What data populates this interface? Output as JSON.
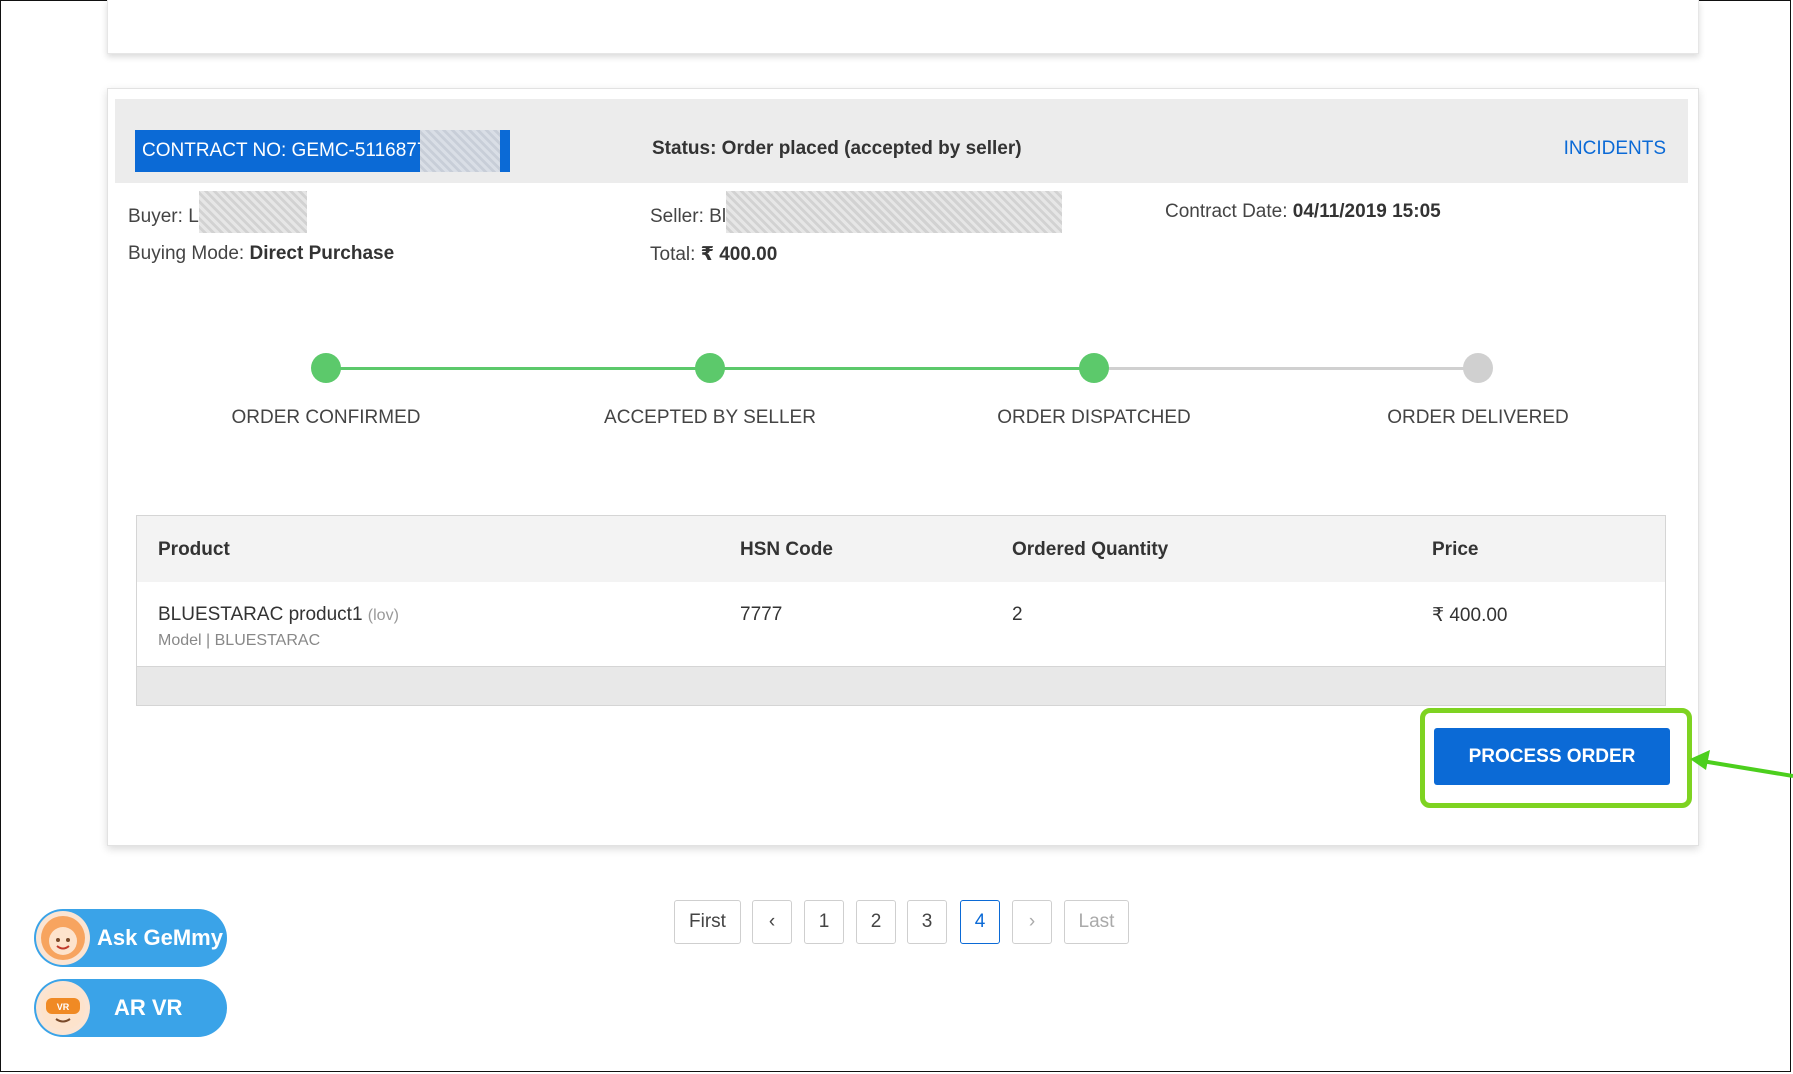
{
  "contract": {
    "number_label": "CONTRACT NO:  GEMC-5116877",
    "status": "Status: Order placed (accepted by seller)",
    "incidents": "INCIDENTS"
  },
  "details": {
    "buyer_label": "Buyer:",
    "buyer_initial": "L",
    "seller_label": "Seller:",
    "seller_initial": "Bl",
    "contract_date_label": "Contract Date:",
    "contract_date": "04/11/2019 15:05",
    "buying_mode_label": "Buying Mode:",
    "buying_mode": "Direct Purchase",
    "total_label": "Total:",
    "total": "₹ 400.00"
  },
  "progress": {
    "steps": [
      {
        "label": "ORDER CONFIRMED",
        "done": true
      },
      {
        "label": "ACCEPTED BY SELLER",
        "done": true
      },
      {
        "label": "ORDER DISPATCHED",
        "done": true
      },
      {
        "label": "ORDER DELIVERED",
        "done": false
      }
    ],
    "done_color": "#5cc96b",
    "pending_color": "#d0d0d0"
  },
  "table": {
    "headers": [
      "Product",
      "HSN Code",
      "Ordered Quantity",
      "Price"
    ],
    "rows": [
      {
        "product": "BLUESTARAC product1",
        "product_tag": "(lov)",
        "model": "Model | BLUESTARAC",
        "hsn": "7777",
        "quantity": "2",
        "price": "₹ 400.00"
      }
    ]
  },
  "actions": {
    "process_order": "PROCESS ORDER"
  },
  "pagination": {
    "first": "First",
    "prev": "‹",
    "pages": [
      "1",
      "2",
      "3",
      "4"
    ],
    "current": "4",
    "next": "›",
    "last": "Last"
  },
  "helpers": {
    "ask": "Ask GeMmy",
    "arvr": "AR VR"
  },
  "colors": {
    "primary": "#0b6ad6",
    "highlight": "#7ed321",
    "helper_pill": "#3aa3e8"
  }
}
